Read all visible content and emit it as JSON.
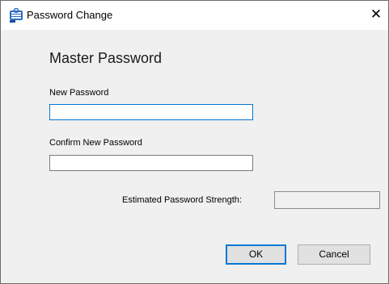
{
  "window": {
    "title": "Password Change",
    "close_glyph": "✕",
    "icon": "keepass-lock-icon"
  },
  "dialog": {
    "heading": "Master Password",
    "new_password": {
      "label": "New Password",
      "value": ""
    },
    "confirm_password": {
      "label": "Confirm New Password",
      "value": ""
    },
    "strength": {
      "label": "Estimated Password Strength:"
    }
  },
  "buttons": {
    "ok_label": "OK",
    "cancel_label": "Cancel"
  },
  "colors": {
    "focus_border": "#0078d7",
    "dialog_background": "#f0f0f0"
  }
}
